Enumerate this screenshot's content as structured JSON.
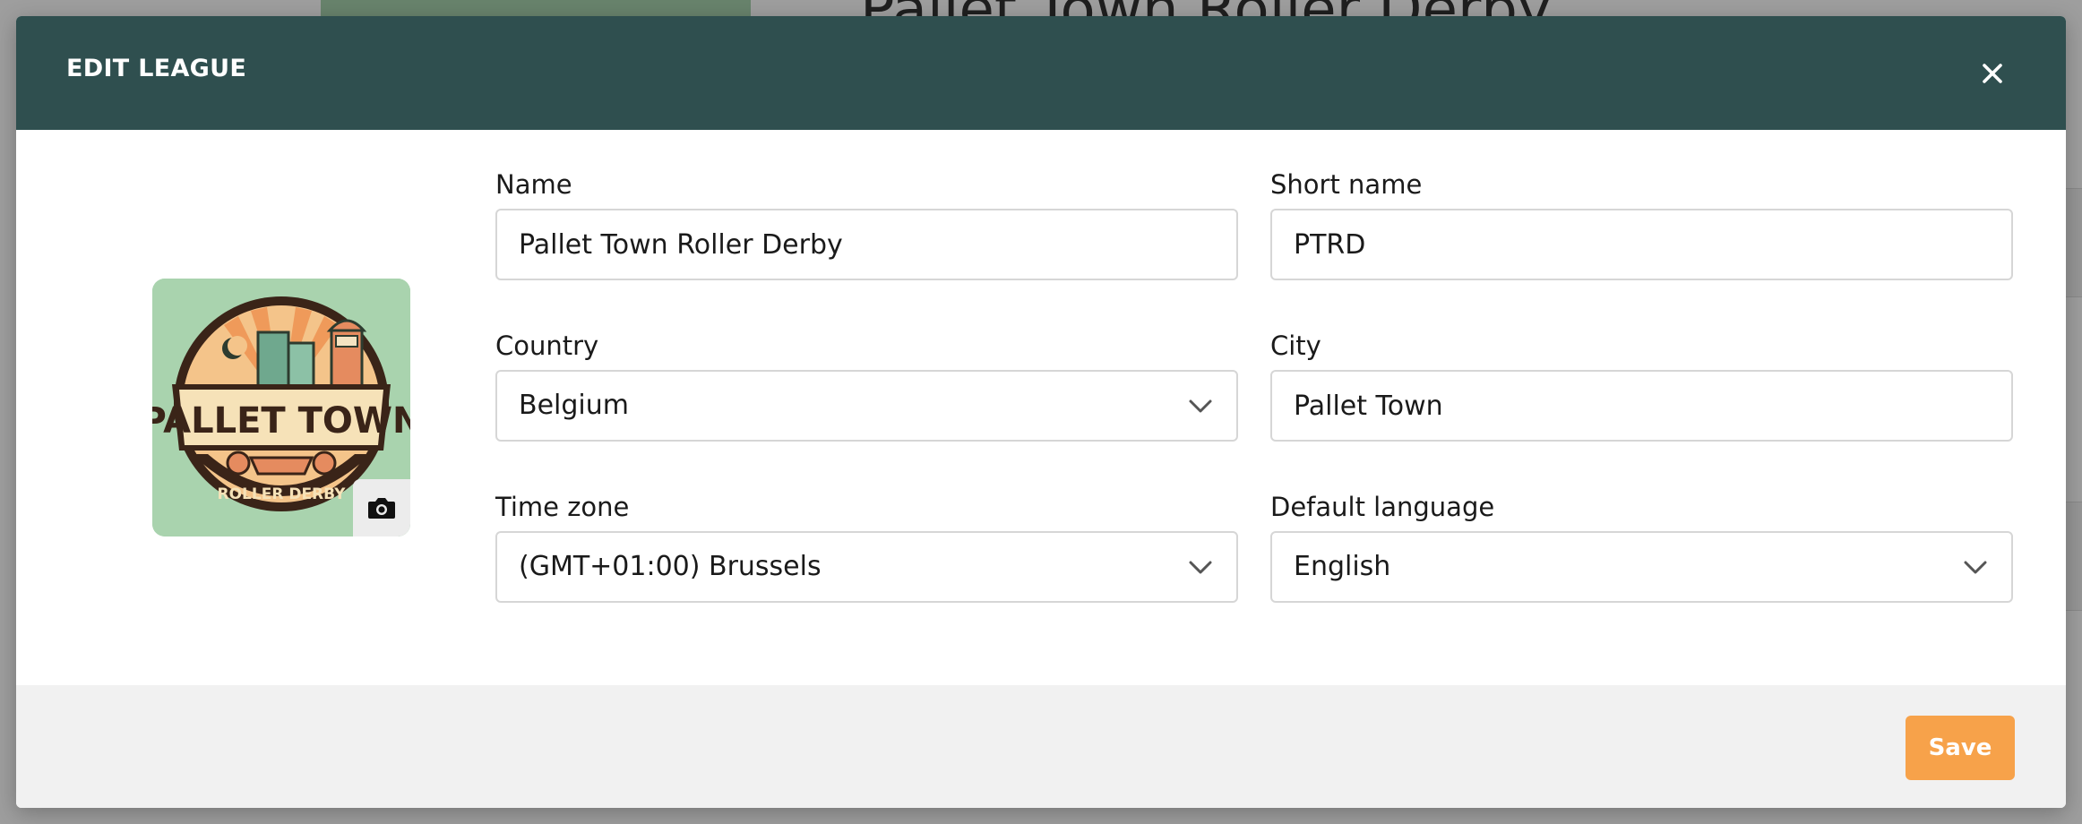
{
  "background": {
    "title": "Pallet Town Roller Derby"
  },
  "modal": {
    "title": "EDIT LEAGUE",
    "close_icon": "close-icon",
    "logo": {
      "camera_icon": "camera-icon",
      "top_text": "PALLET TOWN",
      "bottom_text": "ROLLER DERBY"
    },
    "fields": {
      "name": {
        "label": "Name",
        "value": "Pallet Town Roller Derby"
      },
      "short_name": {
        "label": "Short name",
        "value": "PTRD"
      },
      "country": {
        "label": "Country",
        "value": "Belgium"
      },
      "city": {
        "label": "City",
        "value": "Pallet Town"
      },
      "time_zone": {
        "label": "Time zone",
        "value": "(GMT+01:00) Brussels"
      },
      "default_language": {
        "label": "Default language",
        "value": "English"
      }
    },
    "footer": {
      "save_label": "Save"
    }
  },
  "colors": {
    "header": "#2f4f4f",
    "accent": "#f7a24a",
    "logo_bg": "#a9d3ae",
    "footer": "#f1f1f1"
  }
}
